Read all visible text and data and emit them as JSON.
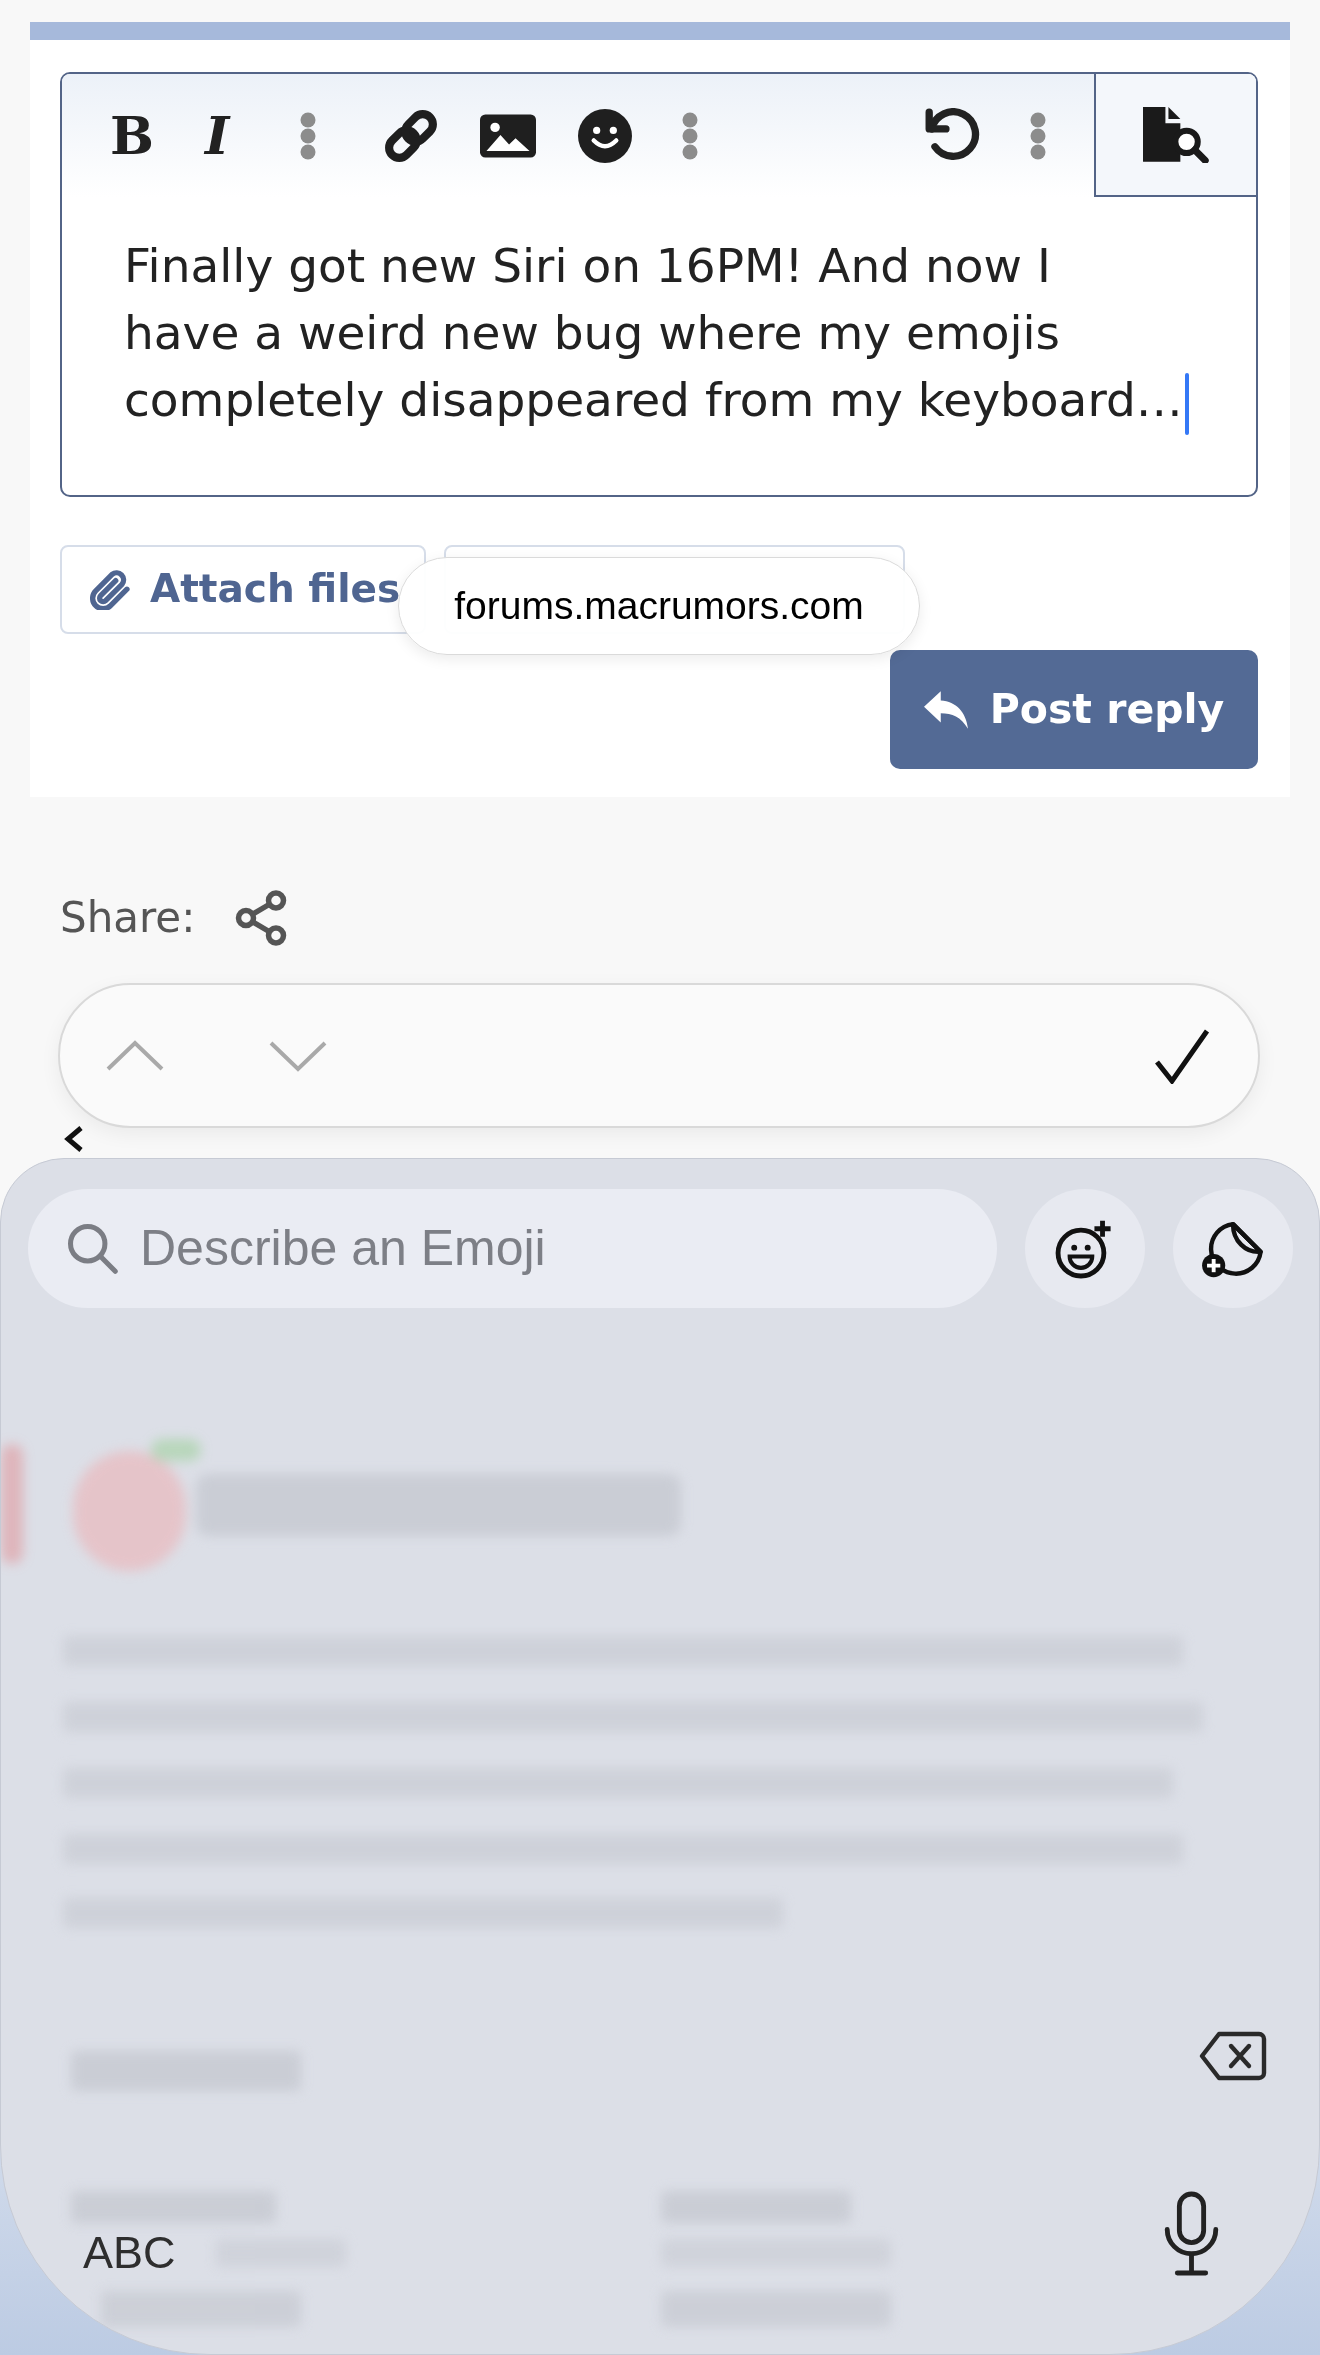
{
  "format_glyphs": [
    {
      "text": "B"
    },
    {
      "text": "I"
    }
  ],
  "editor": {
    "lines": [
      "Finally got new Siri on 16PM! And now I",
      "have a weird new bug where my emojis",
      "completely disappeared from my keyboard…"
    ],
    "focused": true
  },
  "action_buttons": [
    {
      "kind": "attach",
      "label": "Attach files"
    },
    {
      "kind": "covered"
    }
  ],
  "post_button": {
    "label": "Post reply"
  },
  "address_bar": {
    "text": "forums.macrumors.com"
  },
  "share": {
    "label": "Share:"
  },
  "find_bar": {
    "previous": {
      "disabled": true
    },
    "next": {
      "disabled": true
    }
  },
  "emoji_keyboard": {
    "search": {
      "placeholder": "Describe an Emoji"
    },
    "mode_key": "ABC"
  }
}
